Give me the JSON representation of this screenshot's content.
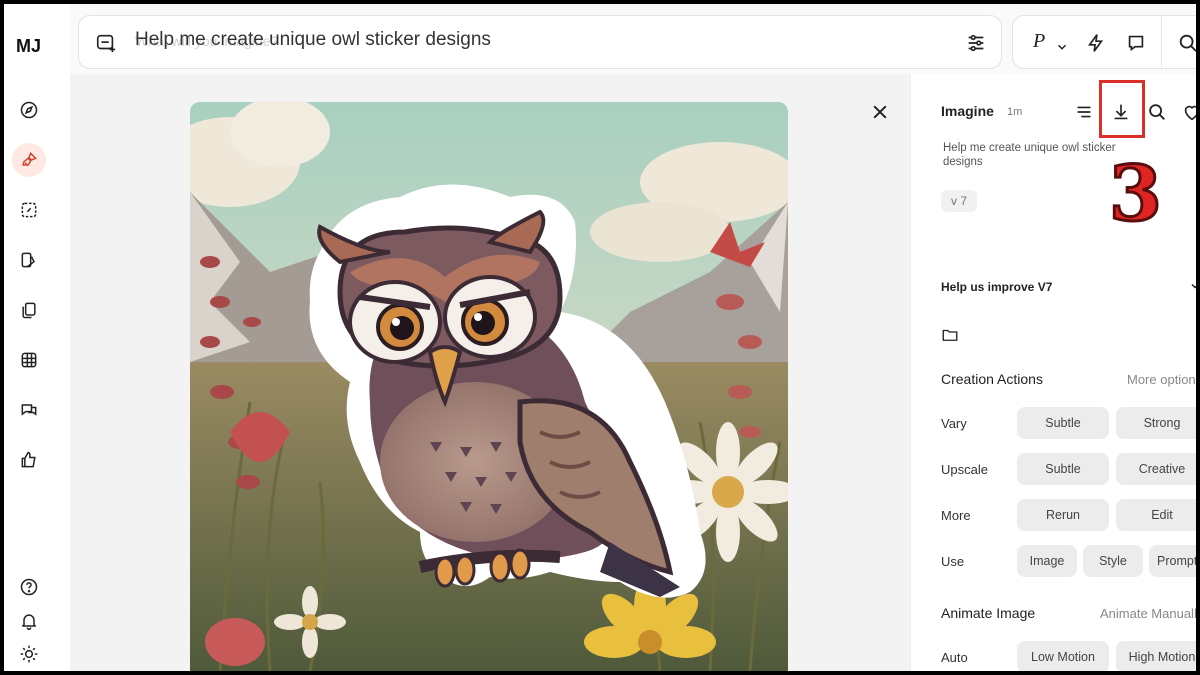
{
  "nav": {
    "logo": "MJ",
    "items": [
      {
        "icon": "compass-icon"
      },
      {
        "icon": "brush-icon",
        "active": true
      },
      {
        "icon": "edit-image-icon"
      },
      {
        "icon": "palette-icon"
      },
      {
        "icon": "copy-icon"
      },
      {
        "icon": "grid-icon"
      },
      {
        "icon": "chat-icon"
      },
      {
        "icon": "thumbs-up-icon"
      }
    ],
    "bottom": [
      {
        "icon": "help-icon"
      },
      {
        "icon": "bell-icon"
      },
      {
        "icon": "sun-icon"
      }
    ]
  },
  "search": {
    "placeholder": "What will you imagine?",
    "value": "Help me create unique owl sticker designs"
  },
  "modebar": {
    "personalize": "P"
  },
  "detail": {
    "mode": "Imagine",
    "time": "1m",
    "prompt": "Help me create unique owl sticker designs",
    "version_chip": "v 7",
    "annotation": "3",
    "improve_label": "Help us improve V7"
  },
  "creation": {
    "title": "Creation Actions",
    "more": "More options",
    "rows": [
      {
        "label": "Vary",
        "buttons": [
          "Subtle",
          "Strong"
        ]
      },
      {
        "label": "Upscale",
        "buttons": [
          "Subtle",
          "Creative"
        ]
      },
      {
        "label": "More",
        "buttons": [
          "Rerun",
          "Edit"
        ]
      },
      {
        "label": "Use",
        "buttons": [
          "Image",
          "Style",
          "Prompt"
        ]
      }
    ]
  },
  "animate": {
    "title": "Animate Image",
    "more": "Animate Manually",
    "rows": [
      {
        "label": "Auto",
        "buttons": [
          "Low Motion",
          "High Motion"
        ]
      }
    ]
  },
  "colors": {
    "accent_highlight": "#d9302a",
    "active_nav_bg": "#fde8e4",
    "button_bg": "#ececec"
  }
}
